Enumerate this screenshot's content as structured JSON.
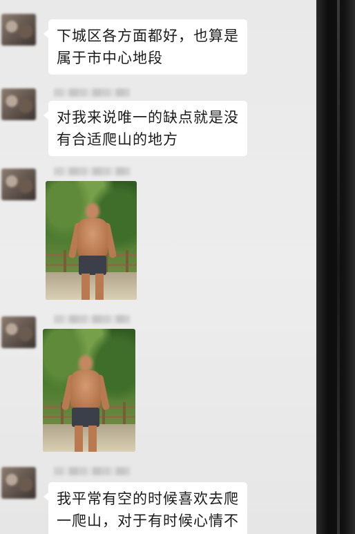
{
  "messages": [
    {
      "type": "text",
      "lines": [
        "下城区各方面都好，也算是",
        "属于市中心地段"
      ]
    },
    {
      "type": "text",
      "lines": [
        "对我来说唯一的缺点就是没",
        "有合适爬山的地方"
      ]
    },
    {
      "type": "image",
      "alt_icon": "shirtless-hiker-photo"
    },
    {
      "type": "image",
      "alt_icon": "shirtless-hiker-photo"
    },
    {
      "type": "text",
      "lines": [
        "我平常有空的时候喜欢去爬",
        "一爬山，对于有时候心情不"
      ]
    }
  ],
  "colors": {
    "screen_bg": "#ebebeb",
    "bubble_bg": "#ffffff",
    "text": "#1b1b1b"
  }
}
